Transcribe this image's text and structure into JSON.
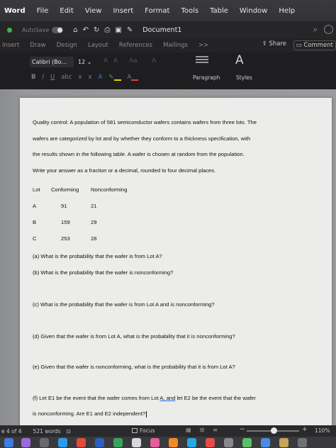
{
  "menubar": {
    "app": "Word",
    "items": [
      "File",
      "Edit",
      "View",
      "Insert",
      "Format",
      "Tools",
      "Table",
      "Window",
      "Help"
    ]
  },
  "titlebar": {
    "autosave_label": "AutoSave",
    "document_title": "Document1"
  },
  "ribbon_tabs": {
    "items": [
      "Insert",
      "Draw",
      "Design",
      "Layout",
      "References",
      "Mailings",
      ">>"
    ],
    "share_label": "Share",
    "comments_label": "Comment"
  },
  "ribbon": {
    "font_name": "Calibri (Bo...",
    "font_size": "12",
    "paragraph_label": "Paragraph",
    "styles_label": "Styles"
  },
  "document": {
    "intro_lines": [
      "Quality control: A population of 581 semiconductor wafers contains wafers from three lots. The",
      "wafers are categorized by lot and by whether they conform to a thickness specification, with",
      "the results shown in the following table. A wafer is chosen at random from the population.",
      "Write your answer as a fraction or a decimal, rounded to four decimal places."
    ],
    "table_headers": [
      "Lot",
      "Conforming",
      "Nonconforming"
    ],
    "table_rows": [
      [
        "A",
        "91",
        "21"
      ],
      [
        "B",
        "159",
        "29"
      ],
      [
        "C",
        "253",
        "28"
      ]
    ],
    "q_a": "(a) What is the probability that the wafer is from Lot A?",
    "q_b": "(b) What is the probability that the wafer is nonconforming?",
    "q_c": "(c) What is the probability that the wafer is from Lot A and is nonconforming?",
    "q_d": "(d) Given that the wafer is from Lot A, what is the probability that it is nonconforming?",
    "q_e": "(e) Given that the wafer is nonconforming, what is the probability that it is from Lot A?",
    "q_f_part1": "(f) Let E1 be the event that the wafer comes from Lot ",
    "q_f_underlined": "A, and",
    "q_f_part2": " let E2 be the event that the wafer",
    "q_f_line2": "is nonconforming. Are E1 and E2 independent?"
  },
  "statusbar": {
    "page": "e 4 of 4",
    "words": "521 words",
    "focus_label": "Focus",
    "zoom": "110%"
  },
  "colors": {
    "highlight": "#e3d400",
    "font_color": "#e04040",
    "autosave_dot": "#3cb44b"
  }
}
